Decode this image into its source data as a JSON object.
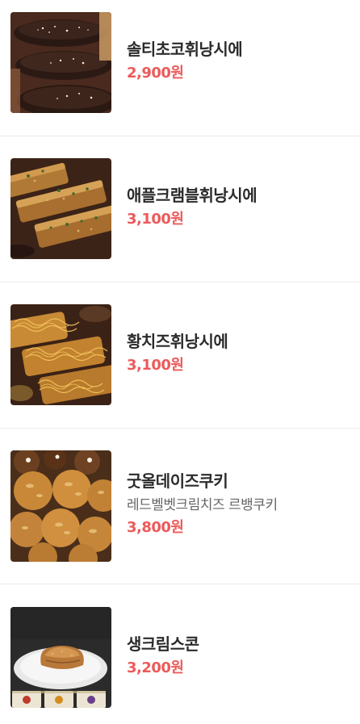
{
  "colors": {
    "name": "#2b2b2b",
    "price": "#ec5a5a",
    "description": "#666666",
    "divider": "#ececec"
  },
  "menu": {
    "items": [
      {
        "name": "솔티초코휘낭시에",
        "description": "",
        "price": "2,900원",
        "image": "salted-chocolate-financier-photo"
      },
      {
        "name": "애플크램블휘낭시에",
        "description": "",
        "price": "3,100원",
        "image": "apple-crumble-financier-photo"
      },
      {
        "name": "황치즈휘낭시에",
        "description": "",
        "price": "3,100원",
        "image": "yellow-cheese-financier-photo"
      },
      {
        "name": "굿올데이즈쿠키",
        "description": "레드벨벳크림치즈 르뱅쿠키",
        "price": "3,800원",
        "image": "good-ol-days-cookie-photo"
      },
      {
        "name": "생크림스콘",
        "description": "",
        "price": "3,200원",
        "image": "fresh-cream-scone-photo"
      }
    ]
  }
}
